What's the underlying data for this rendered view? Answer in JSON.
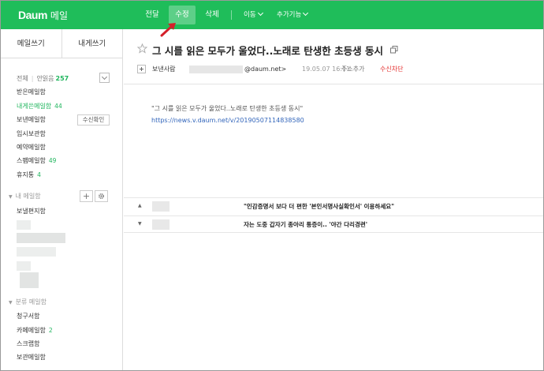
{
  "header": {
    "logo_mark": "Daum",
    "logo_text": "메일",
    "buttons": {
      "forward": "전달",
      "edit": "수정",
      "delete": "삭제",
      "move": "이동",
      "more": "추가기능"
    },
    "brand_color": "#1fbd5a"
  },
  "sidebar": {
    "compose_label": "메일쓰기",
    "to_me_label": "내게쓰기",
    "summary": {
      "all_label": "전체",
      "unread_label": "안읽음",
      "unread_count": "257"
    },
    "folders": [
      {
        "label": "받은메일함",
        "count": ""
      },
      {
        "label": "내게쓴메일함",
        "count": "44"
      },
      {
        "label": "보낸메일함",
        "count": ""
      },
      {
        "label": "임시보관함",
        "count": ""
      },
      {
        "label": "예약메일함",
        "count": ""
      },
      {
        "label": "스팸메일함",
        "count": "49"
      },
      {
        "label": "휴지통",
        "count": "4"
      }
    ],
    "confirm_receipt_label": "수신확인",
    "my_section": {
      "title": "내 메일함",
      "items": [
        {
          "label": "보낼편지함"
        }
      ]
    },
    "category_section": {
      "title": "분류 메일함",
      "items": [
        {
          "label": "청구서함",
          "count": ""
        },
        {
          "label": "카페메일함",
          "count": "2"
        },
        {
          "label": "스크랩함",
          "count": ""
        },
        {
          "label": "보관메일함",
          "count": ""
        }
      ]
    }
  },
  "mail": {
    "subject": "그 시를 읽은 모두가 울었다..노래로 탄생한 초등생 동시",
    "sender_label": "보낸사람",
    "sender_email": "@daum.net>",
    "date": "19.05.07 16:11",
    "add_address": "주소추가",
    "block_receive": "수신차단",
    "body_quote": "\"그 시를 읽은 모두가 울었다..노래로 탄생한 초등생 동시\"",
    "body_link": "https://news.v.daum.net/v/20190507114838580"
  },
  "nav_list": [
    {
      "direction": "up",
      "title": "\"인감증명서 보다 더 편한 '본인서명사실확인서' 이용하세요\""
    },
    {
      "direction": "down",
      "title": "자는 도중 갑자기 종아리 통증이.. '야간 다리경련'"
    }
  ]
}
